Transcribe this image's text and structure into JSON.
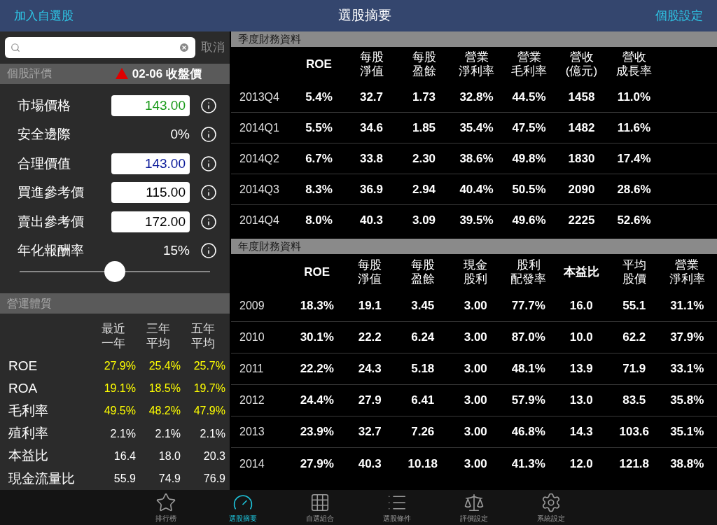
{
  "nav": {
    "left": "加入自選股",
    "title": "選股摘要",
    "right": "個股設定"
  },
  "search": {
    "cancel": "取消"
  },
  "valuation": {
    "title": "個股評價",
    "price_note": "02-06 收盤價",
    "rows": [
      {
        "kind": "field",
        "label": "市場價格",
        "value": "143.00",
        "color": "#1a9a1a"
      },
      {
        "kind": "text",
        "label": "安全邊際",
        "value": "0%"
      },
      {
        "kind": "field",
        "label": "合理價值",
        "value": "143.00",
        "color": "#0a1a9a"
      },
      {
        "kind": "field",
        "label": "買進參考價",
        "value": "115.00",
        "color": "#000000"
      },
      {
        "kind": "field",
        "label": "賣出參考價",
        "value": "172.00",
        "color": "#000000"
      },
      {
        "kind": "text",
        "label": "年化報酬率",
        "value": "15%"
      }
    ],
    "slider": {
      "level": 0.5
    }
  },
  "operations": {
    "title": "營運體質",
    "columns": [
      [
        "最近",
        "一年"
      ],
      [
        "三年",
        "平均"
      ],
      [
        "五年",
        "平均"
      ]
    ],
    "rows": [
      {
        "label": "ROE",
        "values": [
          "27.9%",
          "25.4%",
          "25.7%"
        ],
        "highlight": true
      },
      {
        "label": "ROA",
        "values": [
          "19.1%",
          "18.5%",
          "19.7%"
        ],
        "highlight": true
      },
      {
        "label": "毛利率",
        "values": [
          "49.5%",
          "48.2%",
          "47.9%"
        ],
        "highlight": true
      },
      {
        "label": "殖利率",
        "values": [
          "2.1%",
          "2.1%",
          "2.1%"
        ],
        "highlight": false
      },
      {
        "label": "本益比",
        "values": [
          "16.4",
          "18.0",
          "20.3"
        ],
        "highlight": false
      },
      {
        "label": "現金流量比",
        "values": [
          "55.9",
          "74.9",
          "76.9"
        ],
        "highlight": false
      }
    ]
  },
  "quarterly": {
    "title": "季度財務資料",
    "columns": [
      [
        "ROE"
      ],
      [
        "每股",
        "淨值"
      ],
      [
        "每股",
        "盈餘"
      ],
      [
        "營業",
        "淨利率"
      ],
      [
        "營業",
        "毛利率"
      ],
      [
        "營收",
        "(億元)"
      ],
      [
        "營收",
        "成長率"
      ]
    ],
    "rows": [
      {
        "period": "2013Q4",
        "values": [
          "5.4%",
          "32.7",
          "1.73",
          "32.8%",
          "44.5%",
          "1458",
          "11.0%"
        ]
      },
      {
        "period": "2014Q1",
        "values": [
          "5.5%",
          "34.6",
          "1.85",
          "35.4%",
          "47.5%",
          "1482",
          "11.6%"
        ]
      },
      {
        "period": "2014Q2",
        "values": [
          "6.7%",
          "33.8",
          "2.30",
          "38.6%",
          "49.8%",
          "1830",
          "17.4%"
        ]
      },
      {
        "period": "2014Q3",
        "values": [
          "8.3%",
          "36.9",
          "2.94",
          "40.4%",
          "50.5%",
          "2090",
          "28.6%"
        ]
      },
      {
        "period": "2014Q4",
        "values": [
          "8.0%",
          "40.3",
          "3.09",
          "39.5%",
          "49.6%",
          "2225",
          "52.6%"
        ]
      }
    ]
  },
  "annual": {
    "title": "年度財務資料",
    "columns": [
      [
        "ROE"
      ],
      [
        "每股",
        "淨值"
      ],
      [
        "每股",
        "盈餘"
      ],
      [
        "現金",
        "股利"
      ],
      [
        "股利",
        "配發率"
      ],
      [
        "本益比"
      ],
      [
        "平均",
        "股價"
      ],
      [
        "營業",
        "淨利率"
      ]
    ],
    "rows": [
      {
        "period": "2009",
        "values": [
          "18.3%",
          "19.1",
          "3.45",
          "3.00",
          "77.7%",
          "16.0",
          "55.1",
          "31.1%"
        ]
      },
      {
        "period": "2010",
        "values": [
          "30.1%",
          "22.2",
          "6.24",
          "3.00",
          "87.0%",
          "10.0",
          "62.2",
          "37.9%"
        ]
      },
      {
        "period": "2011",
        "values": [
          "22.2%",
          "24.3",
          "5.18",
          "3.00",
          "48.1%",
          "13.9",
          "71.9",
          "33.1%"
        ]
      },
      {
        "period": "2012",
        "values": [
          "24.4%",
          "27.9",
          "6.41",
          "3.00",
          "57.9%",
          "13.0",
          "83.5",
          "35.8%"
        ]
      },
      {
        "period": "2013",
        "values": [
          "23.9%",
          "32.7",
          "7.26",
          "3.00",
          "46.8%",
          "14.3",
          "103.6",
          "35.1%"
        ]
      },
      {
        "period": "2014",
        "values": [
          "27.9%",
          "40.3",
          "10.18",
          "3.00",
          "41.3%",
          "12.0",
          "121.8",
          "38.8%"
        ]
      }
    ]
  },
  "tabbar": [
    {
      "kind": "star",
      "label": "排行榜",
      "selected": false
    },
    {
      "kind": "gauge",
      "label": "選股摘要",
      "selected": true
    },
    {
      "kind": "grid",
      "label": "自選組合",
      "selected": false
    },
    {
      "kind": "list",
      "label": "選股條件",
      "selected": false
    },
    {
      "kind": "scale",
      "label": "評價設定",
      "selected": false
    },
    {
      "kind": "gear",
      "label": "系統設定",
      "selected": false
    }
  ]
}
